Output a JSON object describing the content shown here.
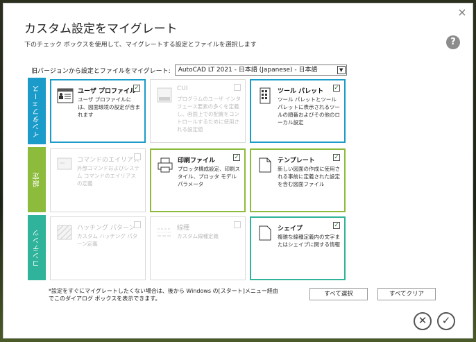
{
  "window": {
    "title": "カスタム設定をマイグレート",
    "subtitle": "下のチェック ボックスを使用して、マイグレートする設定とファイルを選択します",
    "close_label": "×",
    "help_label": "?"
  },
  "version": {
    "label": "旧バージョンから設定とファイルをマイグレート:",
    "selected": "AutoCAD LT 2021 - 日本語 (Japanese) - 日本語",
    "arrow": "▼"
  },
  "categories": {
    "interface": "インタフェース",
    "settings": "設定",
    "content": "コンテンツ"
  },
  "cards": {
    "user_profile": {
      "name": "ユーザ プロファイル",
      "desc": "ユーザ プロファイルには、図面環境の設定が含まれます",
      "checked": true
    },
    "cui": {
      "name": "CUI",
      "desc": "プログラムのユーザ インタフェース要素の多くを定義し、画面上での配置をコントロールするために使用される設定値",
      "checked": false,
      "icon_text": "CUI"
    },
    "tool_palette": {
      "name": "ツール パレット",
      "desc": "ツール パレットとツール パレットに表示されるツールの順番およびその他のローカル設定",
      "checked": true
    },
    "command_alias": {
      "name": "コマンドのエイリアス",
      "desc": "外部コマンドおよびシステム コマンドのエイリアスの定義",
      "checked": false
    },
    "plot_files": {
      "name": "印刷ファイル",
      "desc": "プロッタ構成設定、印刷スタイル、プロッタ モデル パラメータ",
      "checked": true
    },
    "template": {
      "name": "テンプレート",
      "desc": "新しい図面の作成に使用される事前に定義された設定を含む図面ファイル",
      "checked": true
    },
    "hatch": {
      "name": "ハッチング パターン",
      "desc": "カスタム ハッチング パターン定義",
      "checked": false
    },
    "linetype": {
      "name": "線種",
      "desc": "カスタム線種定義",
      "checked": false
    },
    "shape": {
      "name": "シェイプ",
      "desc": "複雑な線種定義内の文字またはシェイプに関する情報",
      "checked": true,
      "icon_text": "ｼｪﾌﾞ"
    }
  },
  "checkmark": "✓",
  "note": {
    "line1": "*設定をすぐにマイグレートしたくない場合は、後から Windows の[スタート]メニュー経由",
    "line2": "でこのダイアログ ボックスを表示できます。"
  },
  "buttons": {
    "select_all": "すべて選択",
    "clear_all": "すべてクリア",
    "cancel_symbol": "✕",
    "ok_symbol": "✓"
  },
  "colors": {
    "interface": "#1a9bc9",
    "settings": "#8dbb3c",
    "content": "#2fb39a"
  }
}
